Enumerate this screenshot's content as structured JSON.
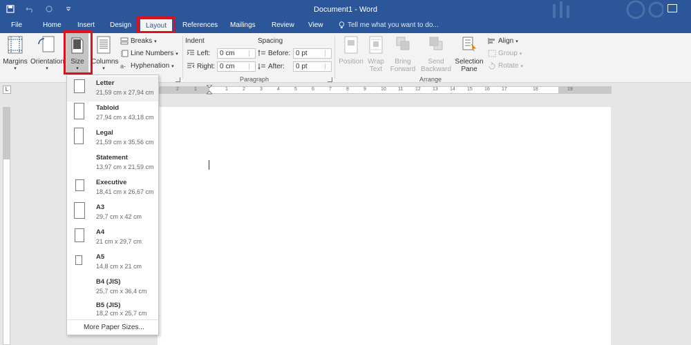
{
  "window": {
    "title": "Document1 - Word"
  },
  "quick_access": {
    "save_icon": "save-icon",
    "undo_icon": "undo-icon",
    "redo_icon": "redo-icon",
    "customize_icon": "customize-qat-icon"
  },
  "tabs": [
    "File",
    "Home",
    "Insert",
    "Design",
    "Layout",
    "References",
    "Mailings",
    "Review",
    "View"
  ],
  "active_tab": "Layout",
  "tell_me": "Tell me what you want to do...",
  "ribbon": {
    "page_setup": {
      "margins": "Margins",
      "orientation": "Orientation",
      "size": "Size",
      "columns": "Columns",
      "breaks": "Breaks",
      "line_numbers": "Line Numbers",
      "hyphenation": "Hyphenation",
      "label": "Page Setup"
    },
    "paragraph": {
      "indent_heading": "Indent",
      "spacing_heading": "Spacing",
      "left_label": "Left:",
      "right_label": "Right:",
      "before_label": "Before:",
      "after_label": "After:",
      "left_value": "0 cm",
      "right_value": "0 cm",
      "before_value": "0 pt",
      "after_value": "0 pt",
      "label": "Paragraph"
    },
    "arrange": {
      "position": "Position",
      "wrap_text_1": "Wrap",
      "wrap_text_2": "Text",
      "bring_forward_1": "Bring",
      "bring_forward_2": "Forward",
      "send_backward_1": "Send",
      "send_backward_2": "Backward",
      "selection_pane_1": "Selection",
      "selection_pane_2": "Pane",
      "align": "Align",
      "group": "Group",
      "rotate": "Rotate",
      "label": "Arrange"
    }
  },
  "ruler": {
    "numbers": [
      "2",
      "1",
      "1",
      "2",
      "3",
      "4",
      "5",
      "6",
      "7",
      "8",
      "9",
      "10",
      "11",
      "12",
      "13",
      "14",
      "15",
      "16",
      "17",
      "18",
      "19"
    ]
  },
  "size_menu": {
    "items": [
      {
        "name": "Letter",
        "dims": "21,59 cm x 27,94 cm"
      },
      {
        "name": "Tabloid",
        "dims": "27,94 cm x 43,18 cm"
      },
      {
        "name": "Legal",
        "dims": "21,59 cm x 35,56 cm"
      },
      {
        "name": "Statement",
        "dims": "13,97 cm x 21,59 cm"
      },
      {
        "name": "Executive",
        "dims": "18,41 cm x 26,67 cm"
      },
      {
        "name": "A3",
        "dims": "29,7 cm x 42 cm"
      },
      {
        "name": "A4",
        "dims": "21 cm x 29,7 cm"
      },
      {
        "name": "A5",
        "dims": "14,8 cm x 21 cm"
      },
      {
        "name": "B4 (JIS)",
        "dims": "25,7 cm x 36,4 cm"
      },
      {
        "name": "B5 (JIS)",
        "dims": "18,2 cm x 25,7 cm"
      }
    ],
    "more": "More Paper Sizes..."
  },
  "colors": {
    "accent": "#2b579a",
    "highlight": "#e0101a"
  }
}
